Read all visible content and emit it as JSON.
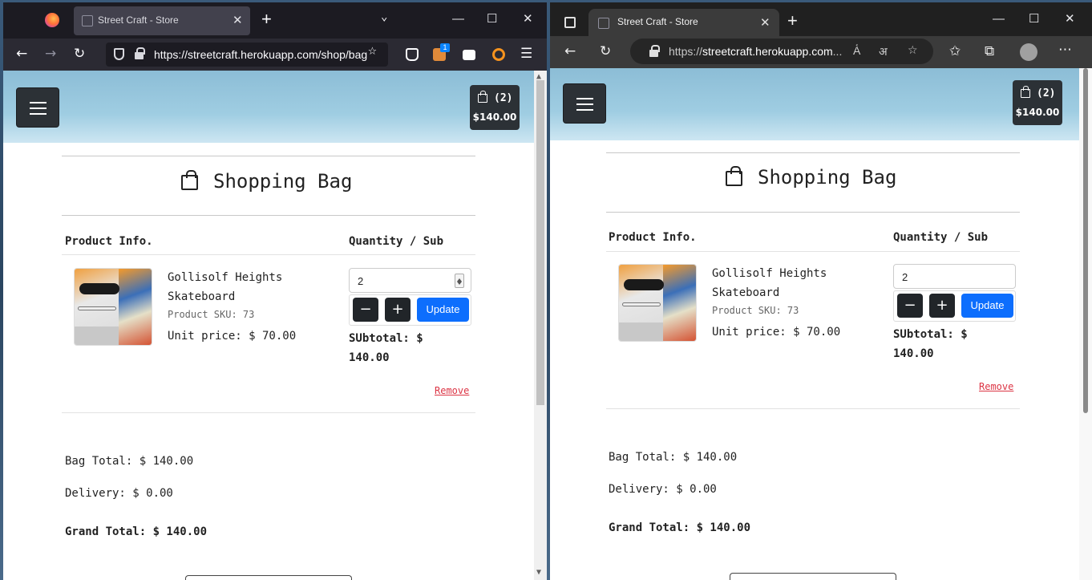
{
  "firefox": {
    "tab_title": "Street Craft - Store",
    "url": "https://streetcraft.herokuapp.com/shop/bag",
    "extension_badge": "1"
  },
  "edge": {
    "tab_title": "Street Craft - Store",
    "url_prefix": "https://",
    "url_host": "streetcraft.herokuapp.com",
    "url_ellipsis": "..."
  },
  "page": {
    "bag_count": "(2)",
    "bag_total": "$140.00",
    "title": "Shopping Bag",
    "headers": {
      "product": "Product Info.",
      "quantity": "Quantity / Sub"
    },
    "item": {
      "name": "Gollisolf Heights Skateboard",
      "sku": "Product SKU: 73",
      "unit_price": "Unit price: $ 70.00",
      "quantity": "2",
      "update_label": "Update",
      "minus_label": "−",
      "plus_label": "+",
      "subtotal": "SUbtotal: $ 140.00",
      "remove_label": "Remove"
    },
    "bag_total_line": "Bag Total: $ 140.00",
    "delivery_line": "Delivery: $ 0.00",
    "grand_total_line": "Grand Total: $ 140.00"
  }
}
